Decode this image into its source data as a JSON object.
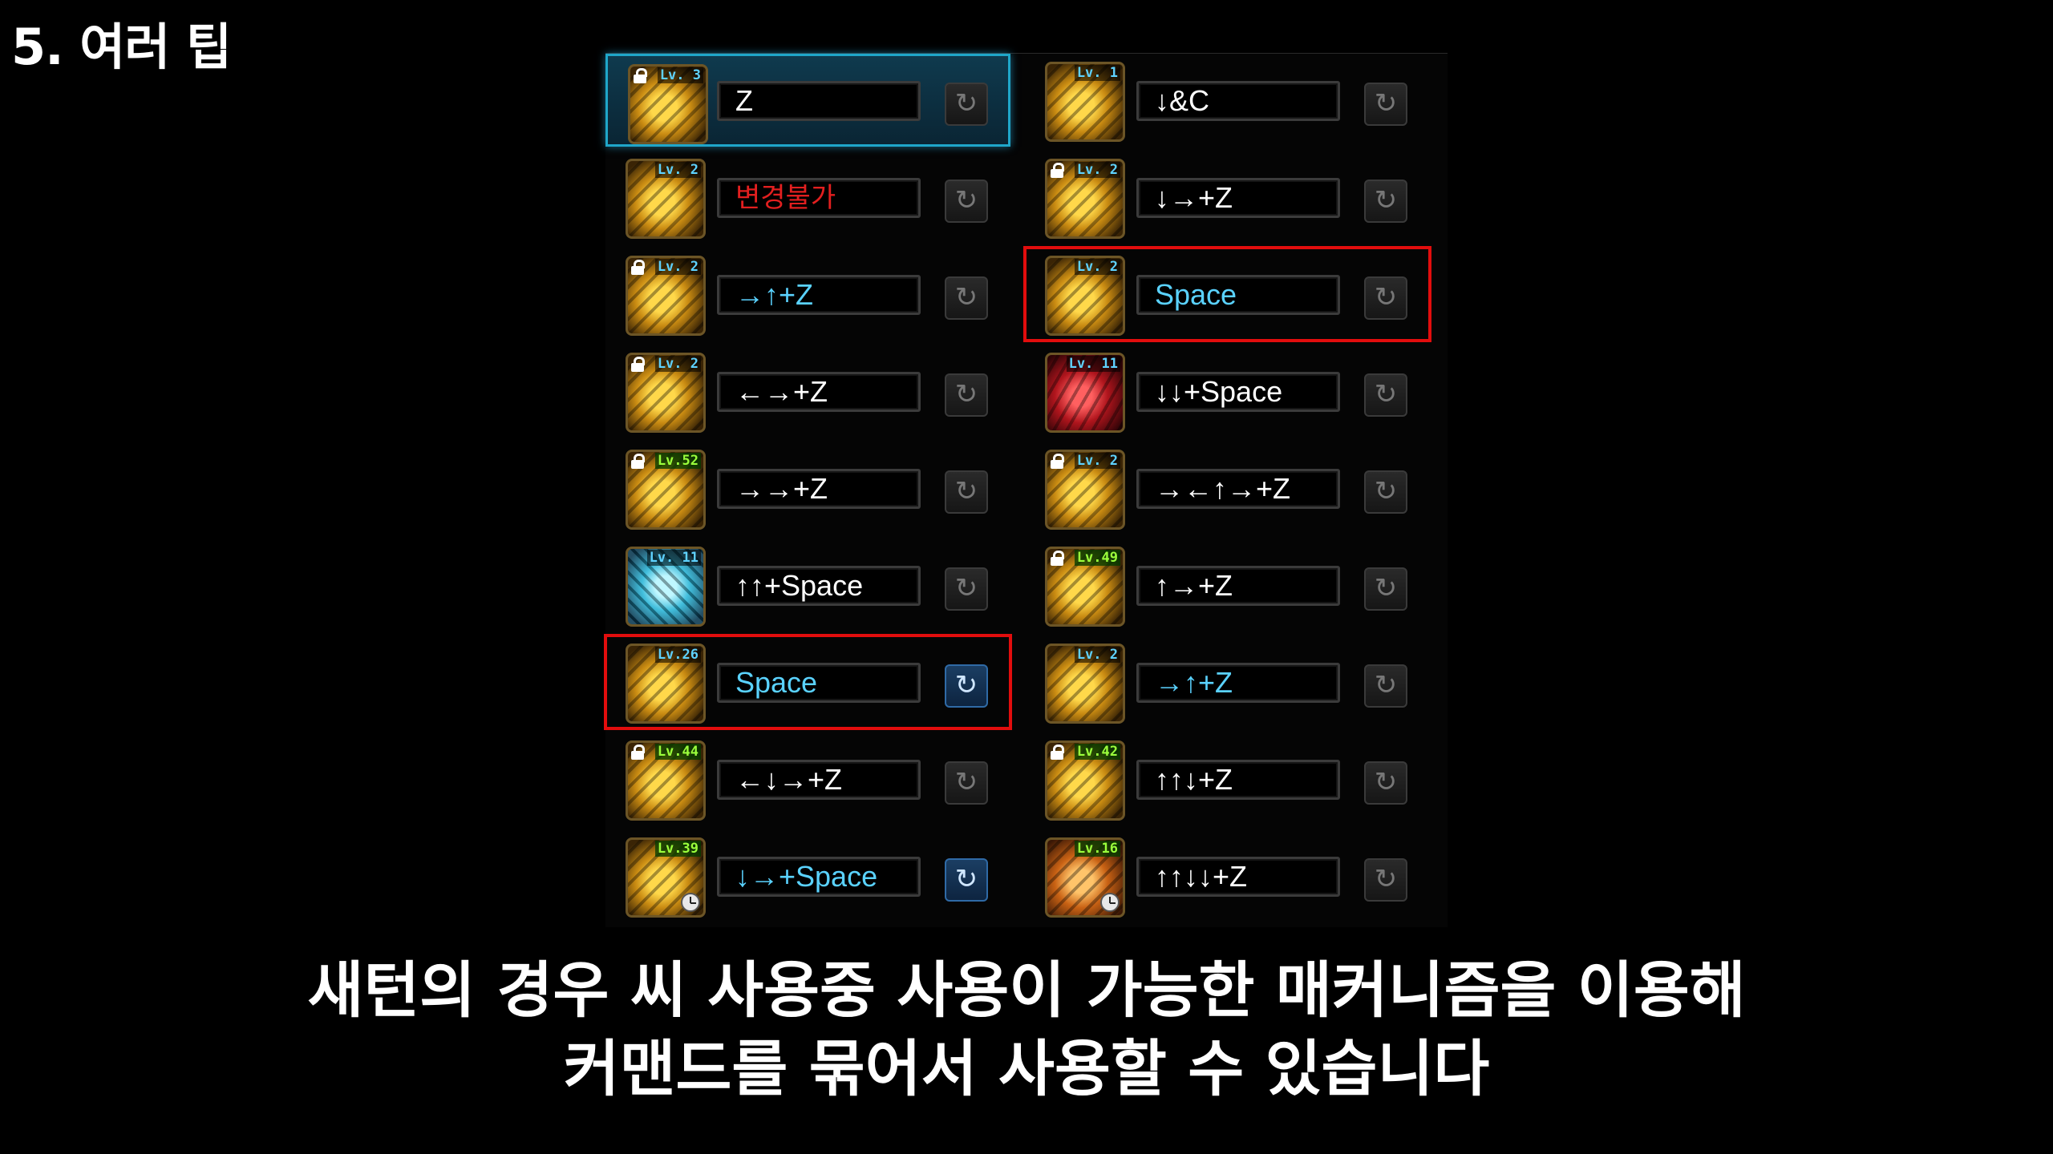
{
  "section_title": "5. 여러 팁",
  "caption": {
    "line1": "새턴의 경우 씨 사용중 사용이 가능한 매커니즘을 이용해",
    "line2": "커맨드를 묶어서 사용할 수 있습니다"
  },
  "reset_icon": "↻",
  "skills": {
    "left": [
      {
        "level": "Lv. 3",
        "command": "Z",
        "locked": true,
        "level_color": "blue",
        "command_color": "white",
        "icon": "slash-icon",
        "selected": true
      },
      {
        "level": "Lv. 2",
        "command": "변경불가",
        "locked": false,
        "level_color": "blue",
        "command_color": "red",
        "icon": "lunge-icon"
      },
      {
        "level": "Lv. 2",
        "command": "→↑+Z",
        "locked": true,
        "level_color": "blue",
        "command_color": "cyan",
        "icon": "uppercut-icon"
      },
      {
        "level": "Lv. 2",
        "command": "←→+Z",
        "locked": true,
        "level_color": "blue",
        "command_color": "white",
        "icon": "fist-icon"
      },
      {
        "level": "Lv.52",
        "command": "→→+Z",
        "locked": true,
        "level_color": "green",
        "command_color": "white",
        "icon": "claw-icon"
      },
      {
        "level": "Lv. 11",
        "command": "↑↑+Space",
        "locked": false,
        "level_color": "blue",
        "command_color": "white",
        "icon": "ice-burst-icon",
        "variant": "ice"
      },
      {
        "level": "Lv.26",
        "command": "Space",
        "locked": false,
        "level_color": "blue",
        "command_color": "cyan",
        "icon": "spin-icon",
        "highlight": true,
        "active_button": true
      },
      {
        "level": "Lv.44",
        "command": "←↓→+Z",
        "locked": true,
        "level_color": "green",
        "command_color": "white",
        "icon": "whirlwind-icon"
      },
      {
        "level": "Lv.39",
        "command": "↓→+Space",
        "locked": false,
        "level_color": "green",
        "command_color": "cyan",
        "icon": "explosion-icon",
        "clock": true,
        "active_button": true
      }
    ],
    "right": [
      {
        "level": "Lv. 1",
        "command": "↓&C",
        "locked": false,
        "level_color": "blue",
        "command_color": "white",
        "icon": "slide-icon"
      },
      {
        "level": "Lv. 2",
        "command": "↓→+Z",
        "locked": true,
        "level_color": "blue",
        "command_color": "white",
        "icon": "dash-icon"
      },
      {
        "level": "Lv. 2",
        "command": "Space",
        "locked": false,
        "level_color": "blue",
        "command_color": "cyan",
        "icon": "charge-icon",
        "highlight": true
      },
      {
        "level": "Lv. 11",
        "command": "↓↓+Space",
        "locked": false,
        "level_color": "blue",
        "command_color": "white",
        "icon": "blood-serpent-icon",
        "variant": "blood"
      },
      {
        "level": "Lv. 2",
        "command": "→←↑→+Z",
        "locked": true,
        "level_color": "blue",
        "command_color": "white",
        "icon": "leap-icon"
      },
      {
        "level": "Lv.49",
        "command": "↑→+Z",
        "locked": true,
        "level_color": "green",
        "command_color": "white",
        "icon": "spear-icon"
      },
      {
        "level": "Lv. 2",
        "command": "→↑+Z",
        "locked": false,
        "level_color": "blue",
        "command_color": "cyan",
        "icon": "rising-icon"
      },
      {
        "level": "Lv.42",
        "command": "↑↑↓+Z",
        "locked": true,
        "level_color": "green",
        "command_color": "white",
        "icon": "vortex-icon"
      },
      {
        "level": "Lv.16",
        "command": "↑↑↓↓+Z",
        "locked": false,
        "level_color": "green",
        "command_color": "white",
        "icon": "flame-beast-icon",
        "variant": "ember",
        "clock": true
      }
    ]
  }
}
